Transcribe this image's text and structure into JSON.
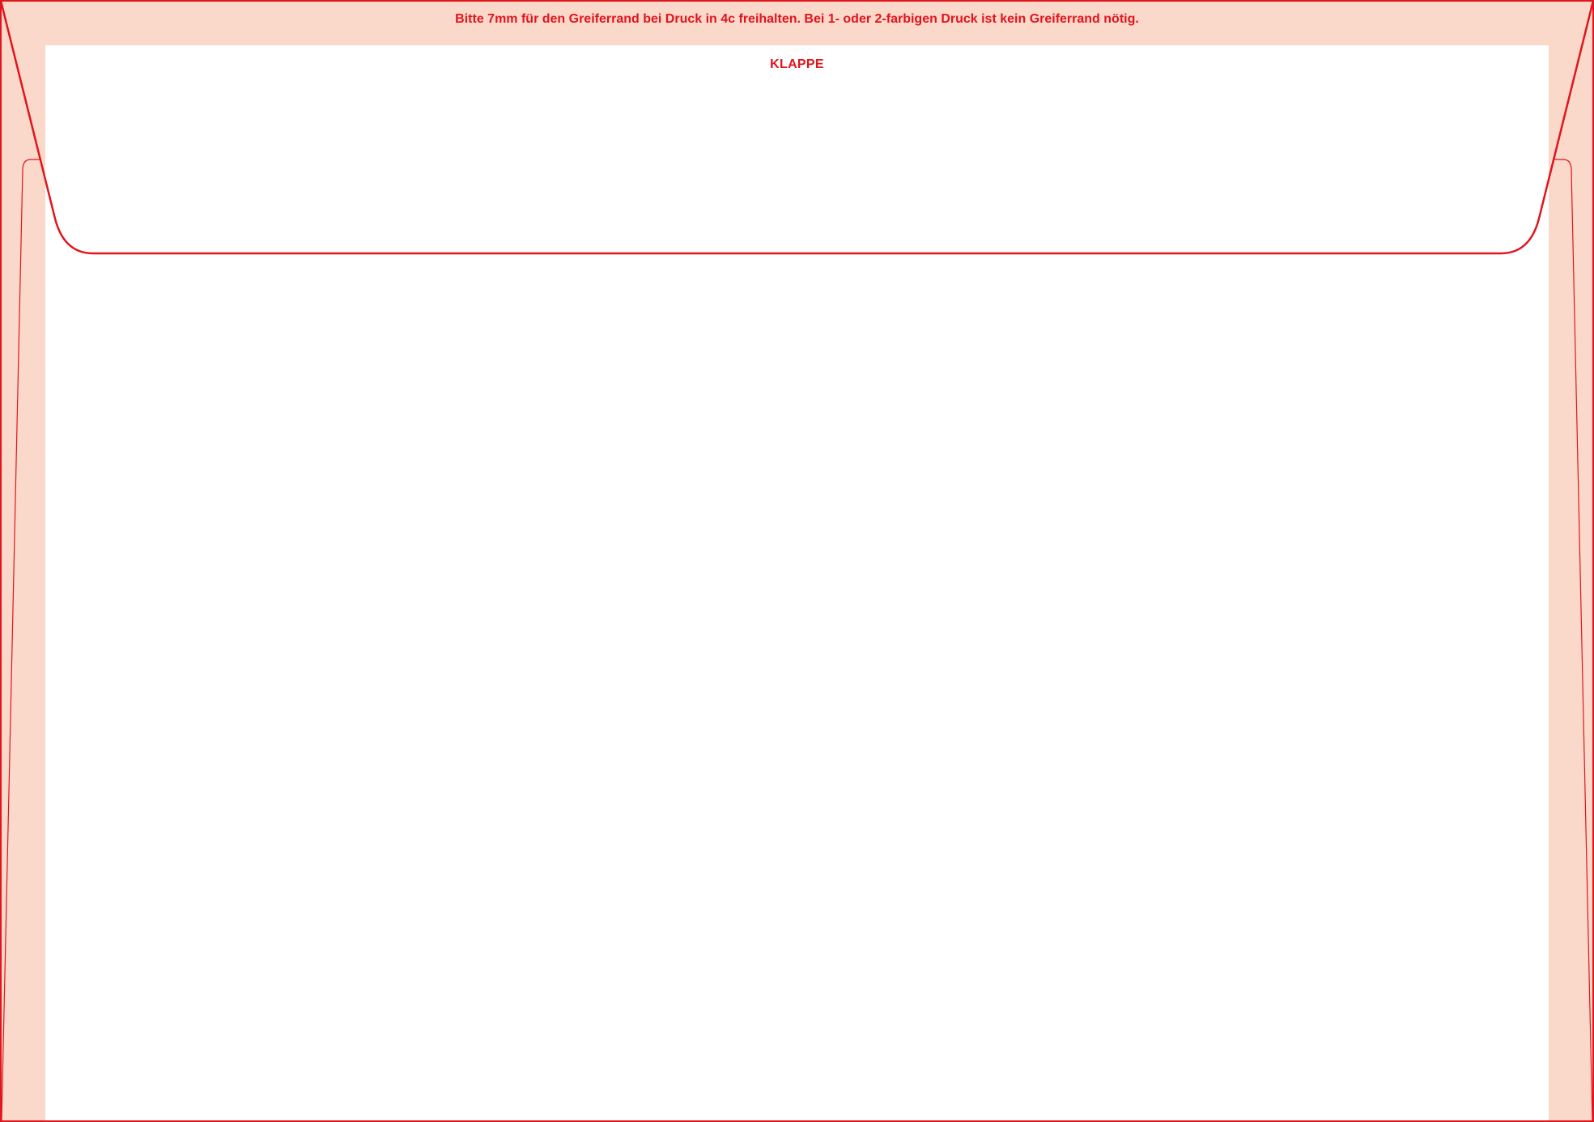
{
  "template": {
    "gripper_notice": "Bitte 7mm für den Greiferrand bei Druck in 4c freihalten. Bei 1- oder 2-farbigen Druck ist kein Greiferrand nötig.",
    "flap_label": "KLAPPE"
  },
  "colors": {
    "line": "#e2141c",
    "gripper_margin": "#fad9ca",
    "background": "#ffffff"
  }
}
